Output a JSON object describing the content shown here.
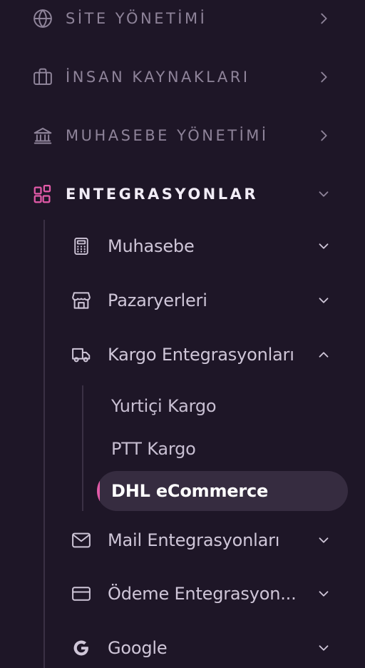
{
  "colors": {
    "background": "#1e1627",
    "muted_text": "#8e8399",
    "active_text": "#f1ecf6",
    "sub_text": "#cfc6d8",
    "accent": "#e25aa8",
    "active_bg": "#362c40"
  },
  "sections": [
    {
      "label": "SİTE YÖNETİMİ",
      "icon": "globe-icon",
      "expanded": false
    },
    {
      "label": "İNSAN KAYNAKLARI",
      "icon": "briefcase-icon",
      "expanded": false
    },
    {
      "label": "MUHASEBE YÖNETİMİ",
      "icon": "bank-icon",
      "expanded": false
    },
    {
      "label": "ENTEGRASYONLAR",
      "icon": "grid-plus-icon",
      "expanded": true
    }
  ],
  "integrations": {
    "items": [
      {
        "label": "Muhasebe",
        "icon": "calculator-icon",
        "expanded": false
      },
      {
        "label": "Pazaryerleri",
        "icon": "store-icon",
        "expanded": false
      },
      {
        "label": "Kargo Entegrasyonları",
        "icon": "truck-icon",
        "expanded": true
      },
      {
        "label": "Mail Entegrasyonları",
        "icon": "mail-icon",
        "expanded": false
      },
      {
        "label": "Ödeme Entegrasyon...",
        "icon": "credit-card-icon",
        "expanded": false
      },
      {
        "label": "Google",
        "icon": "google-icon",
        "expanded": false
      }
    ],
    "cargo_items": [
      {
        "label": "Yurtiçi Kargo",
        "active": false
      },
      {
        "label": "PTT Kargo",
        "active": false
      },
      {
        "label": "DHL eCommerce",
        "active": true
      }
    ]
  }
}
